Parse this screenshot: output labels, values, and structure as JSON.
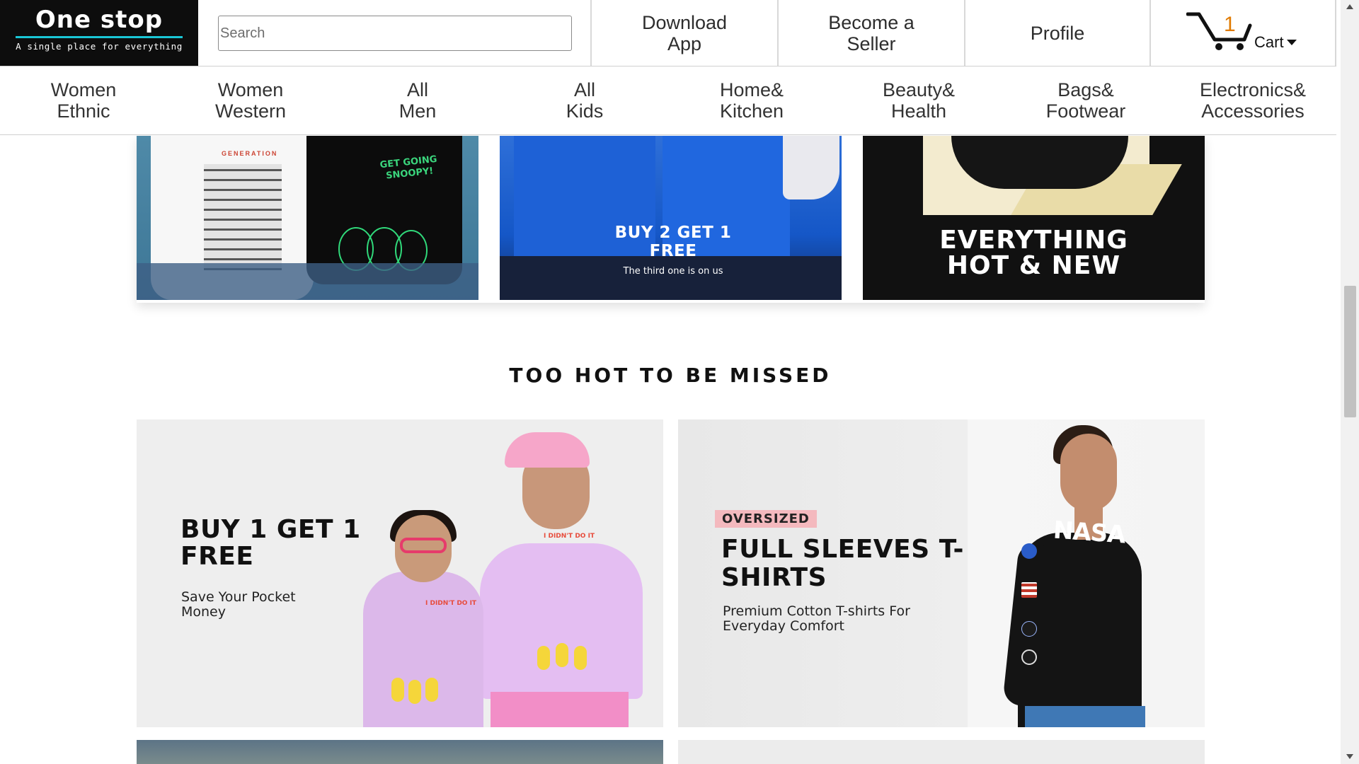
{
  "header": {
    "logo_title": "One stop",
    "logo_tagline": "A single place for everything",
    "search_placeholder": "Search",
    "download_app": "Download App",
    "become_seller": "Become a Seller",
    "profile": "Profile",
    "cart": {
      "count": "1",
      "label": "Cart",
      "icon": "cart-icon"
    }
  },
  "categories": [
    "Women Ethnic",
    "Women Western",
    "All Men",
    "All Kids",
    "Home& Kitchen",
    "Beauty& Health",
    "Bags& Footwear",
    "Electronics& Accessories"
  ],
  "promo_row": {
    "tile1": {
      "shirt_text": "GET GOING SNOOPY!",
      "brand_text": "GENERATION"
    },
    "tile2": {
      "title": "BUY 2 GET 1 FREE",
      "subtitle": "The third one is on us"
    },
    "tile3": {
      "title": "EVERYTHING HOT & NEW"
    }
  },
  "section": {
    "title": "TOO HOT TO BE MISSED"
  },
  "banners": {
    "left": {
      "title": "BUY 1 GET 1 FREE",
      "subtitle": "Save Your Pocket Money",
      "shirt_text": "I DIDN'T DO IT"
    },
    "right": {
      "tag": "OVERSIZED",
      "title": "FULL SLEEVES T-SHIRTS",
      "subtitle": "Premium Cotton T-shirts For Everyday Comfort",
      "shirt_text": "NASA"
    }
  },
  "colors": {
    "logo_bg": "#0d0d0d",
    "logo_accent": "#19c6d6",
    "cart_count": "#e07a00",
    "oversized_tag": "#f4b9be"
  }
}
